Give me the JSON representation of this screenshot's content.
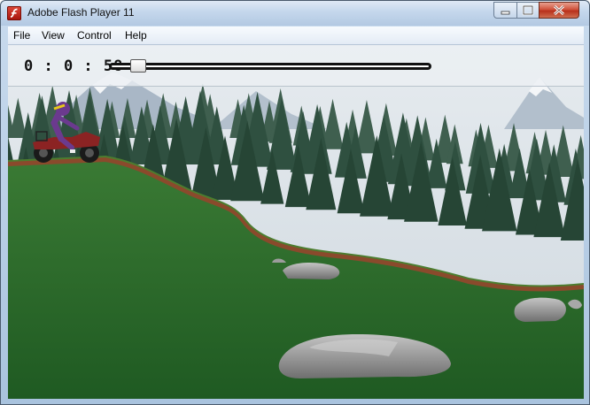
{
  "window": {
    "title": "Adobe Flash Player 11",
    "icon": "flash-icon"
  },
  "menu": {
    "items": [
      {
        "label": "File"
      },
      {
        "label": "View"
      },
      {
        "label": "Control"
      },
      {
        "label": "Help"
      }
    ]
  },
  "game": {
    "timer": "0 : 0 : 58",
    "progress": 0.07
  },
  "colors": {
    "grass": "#2e6a2c",
    "dirt_track": "#8a4a2c",
    "sky": "#dde4ea",
    "atv": "#8b2323",
    "rider": "#6b3a8e"
  }
}
